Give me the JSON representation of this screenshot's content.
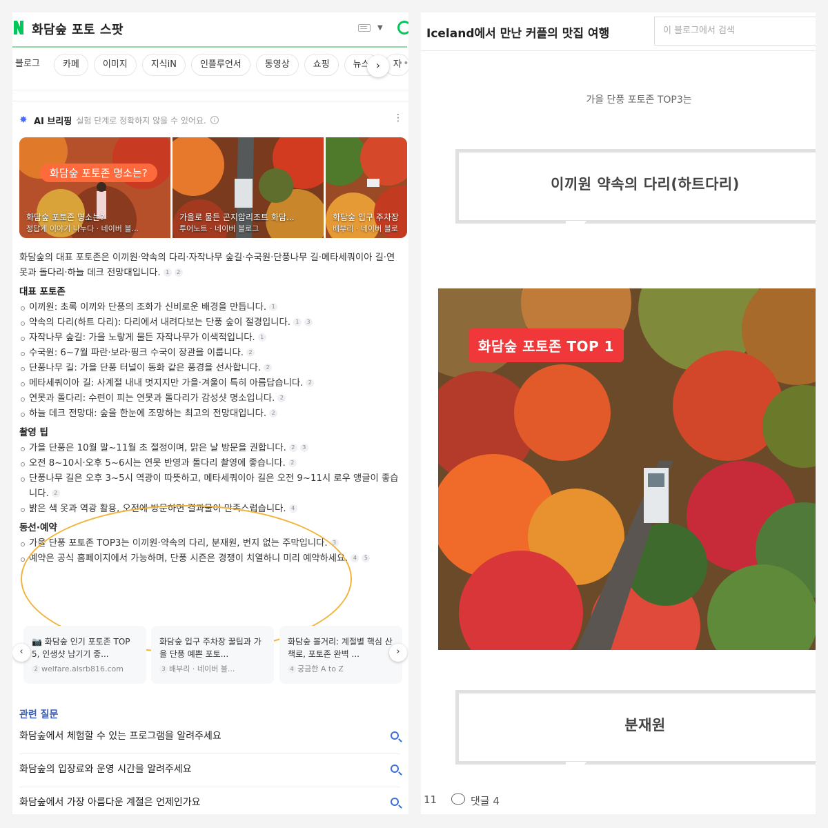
{
  "left": {
    "query": "화담숲 포토 스팟",
    "tabs": [
      "블로그",
      "카페",
      "이미지",
      "지식iN",
      "인플루언서",
      "동영상",
      "쇼핑",
      "뉴스",
      "지"
    ],
    "ai": {
      "title": "AI 브리핑",
      "note": "실험 단계로 정확하지 않을 수 있어요.",
      "info_icon": "ⓘ",
      "thumbs": [
        {
          "pill": "화담숲 포토존 명소는?",
          "cap1": "화담숲 포토존 명소는?",
          "cap2": "정답게 이야기 나누다 · 네이버 블..."
        },
        {
          "pill": "",
          "cap1": "가을로 물든 곤지암리조트 화담...",
          "cap2": "투어노트 · 네이버 블로그"
        },
        {
          "pill": "",
          "cap1": "화담숲 입구 주차장",
          "cap2": "배부리 · 네이버 블로"
        }
      ],
      "intro": "화담숲의 대표 포토존은 이끼원·약속의 다리·자작나무 숲길·수국원·단풍나무 길·메타세쿼이아 길·연못과 돌다리·하늘 데크 전망대입니다.",
      "intro_badges": [
        "1",
        "2"
      ],
      "sections": [
        {
          "title": "대표 포토존",
          "items": [
            {
              "text": "이끼원: 초록 이끼와 단풍의 조화가 신비로운 배경을 만듭니다.",
              "badges": [
                "1"
              ]
            },
            {
              "text": "약속의 다리(하트 다리): 다리에서 내려다보는 단풍 숲이 절경입니다.",
              "badges": [
                "1",
                "3"
              ]
            },
            {
              "text": "자작나무 숲길: 가을 노랗게 물든 자작나무가 이색적입니다.",
              "badges": [
                "1"
              ]
            },
            {
              "text": "수국원: 6~7월 파란·보라·핑크 수국이 장관을 이룹니다.",
              "badges": [
                "2"
              ]
            },
            {
              "text": "단풍나무 길: 가을 단풍 터널이 동화 같은 풍경을 선사합니다.",
              "badges": [
                "2"
              ]
            },
            {
              "text": "메타세쿼이아 길: 사계절 내내 멋지지만 가을·겨울이 특히 아름답습니다.",
              "badges": [
                "2"
              ]
            },
            {
              "text": "연못과 돌다리: 수련이 피는 연못과 돌다리가 감성샷 명소입니다.",
              "badges": [
                "2"
              ]
            },
            {
              "text": "하늘 데크 전망대: 숲을 한눈에 조망하는 최고의 전망대입니다.",
              "badges": [
                "2"
              ]
            }
          ]
        },
        {
          "title": "촬영 팁",
          "items": [
            {
              "text": "가을 단풍은 10월 말~11월 초 절정이며, 맑은 날 방문을 권합니다.",
              "badges": [
                "2",
                "3"
              ]
            },
            {
              "text": "오전 8~10시·오후 5~6시는 연못 반영과 돌다리 촬영에 좋습니다.",
              "badges": [
                "2"
              ]
            },
            {
              "text": "단풍나무 길은 오후 3~5시 역광이 따뜻하고, 메타세쿼이아 길은 오전 9~11시 로우 앵글이 좋습니다.",
              "badges": [
                "2"
              ]
            },
            {
              "text": "밝은 색 옷과 역광 활용, 오전에 방문하면 결과물이 만족스럽습니다.",
              "badges": [
                "4"
              ]
            }
          ]
        },
        {
          "title": "동선·예약",
          "items": [
            {
              "text": "가을 단풍 포토존 TOP3는 이끼원·약속의 다리, 분재원, 번지 없는 주막입니다.",
              "badges": [
                "3"
              ]
            },
            {
              "text": "예약은 공식 홈페이지에서 가능하며, 단풍 시즌은 경쟁이 치열하니 미리 예약하세요.",
              "badges": [
                "4",
                "5"
              ]
            }
          ]
        }
      ],
      "sources": [
        {
          "title": "📷 화담숲 인기 포토존 TOP 5, 인생샷 남기기 좋...",
          "num": "2",
          "meta": "welfare.alsrb816.com"
        },
        {
          "title": "화담숲 입구 주차장 꿀팁과 가을 단풍 예쁜 포토...",
          "num": "3",
          "meta": "배부리 · 네이버 블..."
        },
        {
          "title": "화담숲 볼거리: 계절별 핵심 산책로, 포토존 완벽 ...",
          "num": "4",
          "meta": "궁금한 A to Z"
        }
      ]
    },
    "related": {
      "title": "관련 질문",
      "items": [
        "화담숲에서 체험할 수 있는 프로그램을 알려주세요",
        "화담숲의 입장료와 운영 시간을 알려주세요",
        "화담숲에서 가장 아름다운 계절은 언제인가요"
      ]
    }
  },
  "right": {
    "blog_title": "Iceland에서 만난 커플의 맛집 여행",
    "search_placeholder": "이 블로그에서 검색",
    "subtitle": "가을 단풍 포토존 TOP3는",
    "quote1": "이끼원 약속의 다리(하트다리)",
    "photo_label": "화담숲 포토존 TOP 1",
    "quote2": "분재원",
    "likes": "11",
    "comments": "댓글 4"
  },
  "colors": {
    "naver_green": "#03c75a",
    "annotation_circle": "#f1b43c",
    "photo_label_bg": "#f0383a",
    "related_title": "#3a5fb8"
  }
}
